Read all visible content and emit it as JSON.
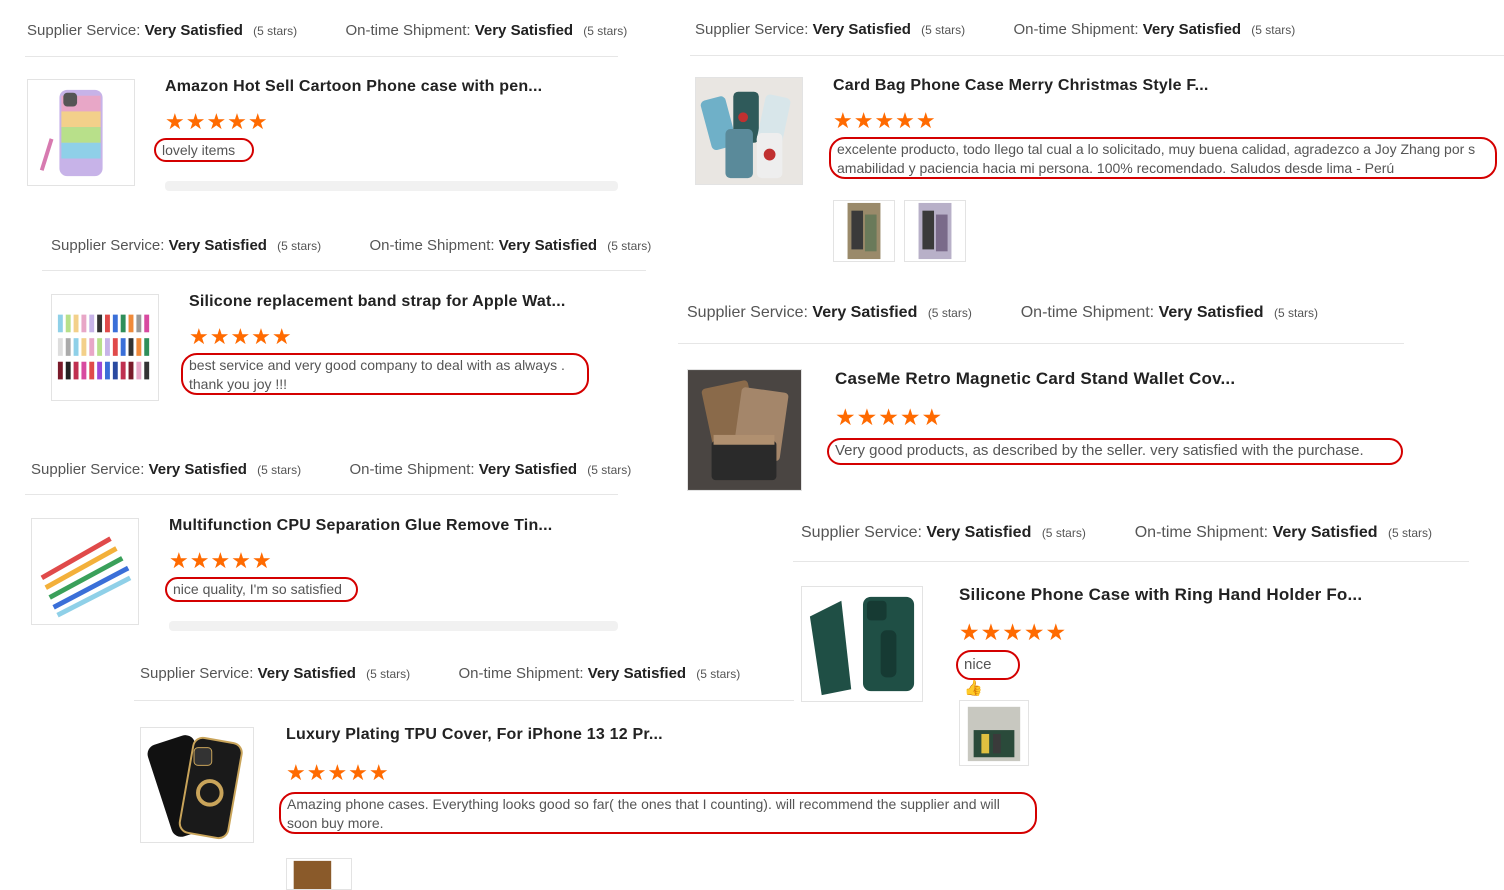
{
  "labels": {
    "supplier_service": "Supplier Service:",
    "ontime_shipment": "On-time Shipment:",
    "rating_value": "Very Satisfied",
    "rating_stars_note": "(5 stars)",
    "stars": "★★★★★",
    "thumb_emoji": "👍"
  },
  "reviews": [
    {
      "product_title": "Amazon Hot Sell Cartoon Phone case with pen...",
      "comment": "lovely items",
      "image_icon": "phone-case-pastel"
    },
    {
      "product_title": "Silicone replacement band strap for Apple Wat...",
      "comment": "best service and very good company to deal with as always . thank you joy !!!",
      "image_icon": "watch-straps"
    },
    {
      "product_title": "Multifunction CPU Separation Glue Remove Tin...",
      "comment": "nice quality, I'm so satisfied",
      "image_icon": "pry-tools"
    },
    {
      "product_title": "Luxury Plating TPU Cover, For iPhone 13 12 Pr...",
      "comment": "Amazing phone cases. Everything looks good so far( the ones that I counting). will recommend the supplier and will soon buy more.",
      "image_icon": "black-ring-case"
    },
    {
      "product_title": "Card Bag Phone Case Merry Christmas Style F...",
      "comment": "excelente producto, todo llego tal cual a lo solicitado, muy buena calidad, agradezco a Joy Zhang por s amabilidad y paciencia hacia mi persona. 100% recomendado. Saludos desde lima - Perú",
      "image_icon": "christmas-cases"
    },
    {
      "product_title": "CaseMe Retro Magnetic Card Stand Wallet Cov...",
      "comment": "Very good products, as described by the seller. very satisfied with the purchase.",
      "image_icon": "wallet-covers"
    },
    {
      "product_title": "Silicone Phone Case with Ring Hand Holder Fo...",
      "comment": "nice",
      "image_icon": "green-holder-case"
    }
  ]
}
